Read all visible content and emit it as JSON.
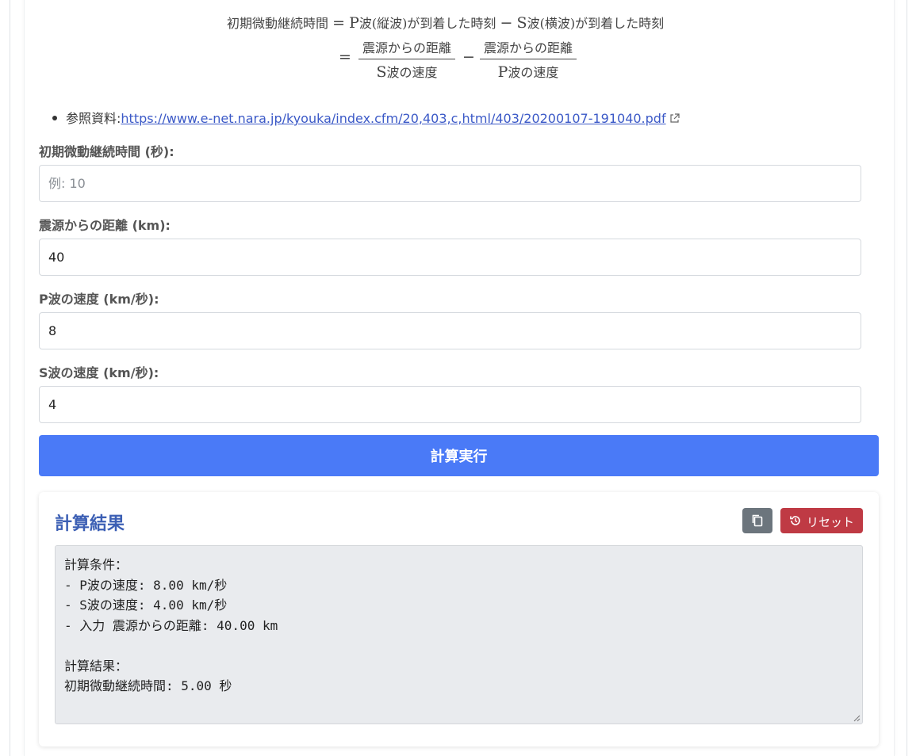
{
  "formula": {
    "line1_lhs": "初期微動継続時間",
    "line1_eq": "=",
    "p_letter": "P",
    "p_wave": "波(縦波)",
    "arrival": "が到着した時刻",
    "minus": "−",
    "s_letter": "S",
    "s_wave": "波(横波)",
    "arrival2": "が到着した時刻",
    "line2_eq": "=",
    "frac1_num": "震源からの距離",
    "frac1_den_letter": "S",
    "frac1_den_text": "波の速度",
    "frac2_num": "震源からの距離",
    "frac2_den_letter": "P",
    "frac2_den_text": "波の速度"
  },
  "reference": {
    "label": "参照資料:",
    "url": "https://www.e-net.nara.jp/kyouka/index.cfm/20,403,c,html/403/20200107-191040.pdf"
  },
  "form": {
    "duration_label": "初期微動継続時間 (秒):",
    "duration_value": "",
    "duration_placeholder": "例: 10",
    "distance_label": "震源からの距離 (km):",
    "distance_value": "40",
    "p_speed_label": "P波の速度 (km/秒):",
    "p_speed_value": "8",
    "s_speed_label": "S波の速度 (km/秒):",
    "s_speed_value": "4",
    "calc_button": "計算実行"
  },
  "result": {
    "title": "計算結果",
    "reset_label": "リセット",
    "text": "計算条件：\n- P波の速度: 8.00 km/秒\n- S波の速度: 4.00 km/秒\n- 入力 震源からの距離: 40.00 km\n\n計算結果：\n初期微動継続時間: 5.00 秒"
  },
  "colors": {
    "primary": "#4a7af7",
    "danger": "#bf3a44",
    "secondary": "#6c757d",
    "title": "#3c5fb4"
  }
}
